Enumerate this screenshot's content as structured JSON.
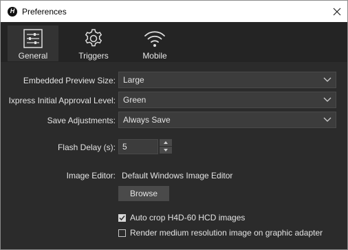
{
  "window": {
    "title": "Preferences"
  },
  "tabs": [
    {
      "label": "General",
      "icon": "sliders-icon",
      "active": true
    },
    {
      "label": "Triggers",
      "icon": "gear-icon",
      "active": false
    },
    {
      "label": "Mobile",
      "icon": "wifi-icon",
      "active": false
    }
  ],
  "settings": {
    "preview_size": {
      "label": "Embedded Preview Size:",
      "value": "Large"
    },
    "approval_level": {
      "label": "Ixpress Initial Approval Level:",
      "value": "Green"
    },
    "save_adjustments": {
      "label": "Save Adjustments:",
      "value": "Always Save"
    },
    "flash_delay": {
      "label": "Flash Delay (s):",
      "value": "5"
    },
    "image_editor": {
      "label": "Image Editor:",
      "value": "Default Windows Image Editor",
      "browse_label": "Browse"
    },
    "auto_crop": {
      "label": "Auto crop H4D-60 HCD images",
      "checked": true
    },
    "render_medium": {
      "label": "Render medium resolution image on graphic adapter",
      "checked": false
    }
  }
}
